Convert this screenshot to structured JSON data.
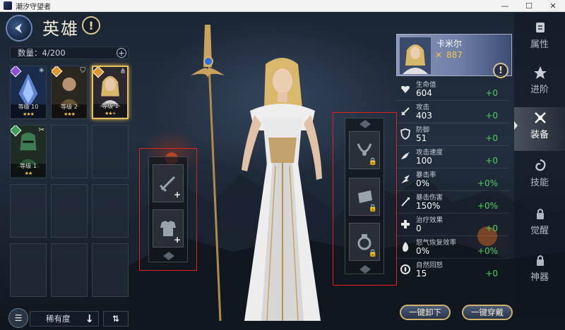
{
  "window": {
    "title": "潮汐守望者",
    "minimize_glyph": "—",
    "maximize_glyph": "☐",
    "close_glyph": "✕"
  },
  "header": {
    "title": "英雄",
    "info_glyph": "!"
  },
  "roster": {
    "count_label": "数量：4/200",
    "add_glyph": "+",
    "heroes": [
      {
        "level": "等级 10",
        "element_color": "#8c4fd8",
        "role_icon": "sparkle-icon",
        "role_glyph": "✳",
        "stars_on": "★★★",
        "stars_off": "",
        "selected": false
      },
      {
        "level": "等级 2",
        "element_color": "#e0962e",
        "role_icon": "shield-icon",
        "role_glyph": "⛉",
        "stars_on": "★★★",
        "stars_off": "",
        "selected": false
      },
      {
        "level": "等级 1",
        "element_color": "#e0962e",
        "role_icon": "support-icon",
        "role_glyph": "⋔",
        "stars_on": "★★",
        "stars_off": "★",
        "selected": true
      },
      {
        "level": "等级 1",
        "element_color": "#3aa05a",
        "role_icon": "crossed-swords-icon",
        "role_glyph": "✂",
        "stars_on": "★★",
        "stars_off": "",
        "selected": false
      }
    ]
  },
  "sort": {
    "filter_glyph": "☰",
    "label": "稀有度",
    "arrow_glyph": "↓",
    "swap_glyph": "⇅"
  },
  "equipment": {
    "left_slots": [
      {
        "icon": "sword-icon",
        "plus": "+"
      },
      {
        "icon": "armor-icon",
        "plus": "+"
      }
    ],
    "right_slots": [
      {
        "icon": "necklace-icon",
        "lock": "🔒"
      },
      {
        "icon": "bracer-icon",
        "lock": "🔒"
      },
      {
        "icon": "ring-icon",
        "lock": "🔒"
      }
    ]
  },
  "hero": {
    "name": "卡米尔",
    "power_glyph": "✕",
    "power": "887",
    "info_glyph": "!"
  },
  "stats": [
    {
      "icon": "heart-icon",
      "name": "生命值",
      "value": "604",
      "delta": "+0"
    },
    {
      "icon": "sword-icon",
      "name": "攻击",
      "value": "403",
      "delta": "+0"
    },
    {
      "icon": "shield-icon",
      "name": "防御",
      "value": "51",
      "delta": "+0"
    },
    {
      "icon": "wing-icon",
      "name": "攻击速度",
      "value": "100",
      "delta": "+0"
    },
    {
      "icon": "crit-icon",
      "name": "暴击率",
      "value": "0%",
      "delta": "+0%"
    },
    {
      "icon": "crit-damage-icon",
      "name": "暴击伤害",
      "value": "150%",
      "delta": "+0%"
    },
    {
      "icon": "heal-cross-icon",
      "name": "治疗效果",
      "value": "0",
      "delta": "+0"
    },
    {
      "icon": "rage-icon",
      "name": "怒气恢复效率",
      "value": "0%",
      "delta": "+0%"
    },
    {
      "icon": "regen-icon",
      "name": "自然回怒",
      "value": "15",
      "delta": "+0"
    }
  ],
  "tabs": [
    {
      "label": "属性",
      "icon": "scroll-icon",
      "active": false
    },
    {
      "label": "进阶",
      "icon": "ascend-icon",
      "active": false
    },
    {
      "label": "装备",
      "icon": "crossed-swords-icon",
      "active": true
    },
    {
      "label": "技能",
      "icon": "swirl-icon",
      "active": false
    },
    {
      "label": "觉醒",
      "icon": "lock-icon",
      "active": false
    },
    {
      "label": "神器",
      "icon": "lock-icon",
      "active": false
    }
  ],
  "actions": {
    "unequip_all": "一键卸下",
    "equip_all": "一键穿戴"
  }
}
